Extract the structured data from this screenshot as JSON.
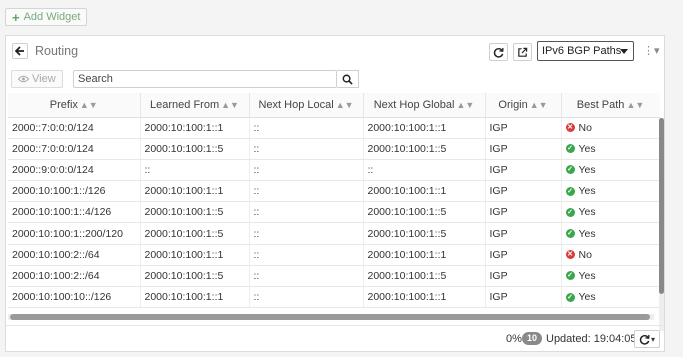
{
  "add_widget": {
    "label": "Add Widget"
  },
  "widget": {
    "title": "Routing",
    "select_value": "IPv6 BGP Paths",
    "view_label": "View",
    "search_placeholder": "Search"
  },
  "table": {
    "columns": [
      "Prefix",
      "Learned From",
      "Next Hop Local",
      "Next Hop Global",
      "Origin",
      "Best Path"
    ],
    "rows": [
      {
        "prefix": "2000::7:0:0:0/124",
        "learned_from": "2000:10:100:1::1",
        "nh_local": "::",
        "nh_global": "2000:10:100:1::1",
        "origin": "IGP",
        "best": "No"
      },
      {
        "prefix": "2000::7:0:0:0/124",
        "learned_from": "2000:10:100:1::5",
        "nh_local": "::",
        "nh_global": "2000:10:100:1::5",
        "origin": "IGP",
        "best": "Yes"
      },
      {
        "prefix": "2000::9:0:0:0/124",
        "learned_from": "::",
        "nh_local": "::",
        "nh_global": "::",
        "origin": "IGP",
        "best": "Yes"
      },
      {
        "prefix": "2000:10:100:1::/126",
        "learned_from": "2000:10:100:1::1",
        "nh_local": "::",
        "nh_global": "2000:10:100:1::1",
        "origin": "IGP",
        "best": "Yes"
      },
      {
        "prefix": "2000:10:100:1::4/126",
        "learned_from": "2000:10:100:1::5",
        "nh_local": "::",
        "nh_global": "2000:10:100:1::5",
        "origin": "IGP",
        "best": "Yes"
      },
      {
        "prefix": "2000:10:100:1::200/120",
        "learned_from": "2000:10:100:1::5",
        "nh_local": "::",
        "nh_global": "2000:10:100:1::5",
        "origin": "IGP",
        "best": "Yes"
      },
      {
        "prefix": "2000:10:100:2::/64",
        "learned_from": "2000:10:100:1::1",
        "nh_local": "::",
        "nh_global": "2000:10:100:1::1",
        "origin": "IGP",
        "best": "No"
      },
      {
        "prefix": "2000:10:100:2::/64",
        "learned_from": "2000:10:100:1::5",
        "nh_local": "::",
        "nh_global": "2000:10:100:1::5",
        "origin": "IGP",
        "best": "Yes"
      },
      {
        "prefix": "2000:10:100:10::/126",
        "learned_from": "2000:10:100:1::1",
        "nh_local": "::",
        "nh_global": "2000:10:100:1::1",
        "origin": "IGP",
        "best": "Yes"
      }
    ]
  },
  "footer": {
    "percent": "0%",
    "count": "10",
    "updated": "Updated: 19:04:05"
  },
  "colors": {
    "yes": "#3aa74a",
    "no": "#d63d3d",
    "accent": "#5fa55f"
  },
  "icons": [
    "plus-icon",
    "back-arrow-icon",
    "refresh-icon",
    "external-link-icon",
    "kebab-menu-icon",
    "eye-icon",
    "search-icon",
    "check-circle-icon",
    "x-circle-icon",
    "chevron-down-icon"
  ]
}
